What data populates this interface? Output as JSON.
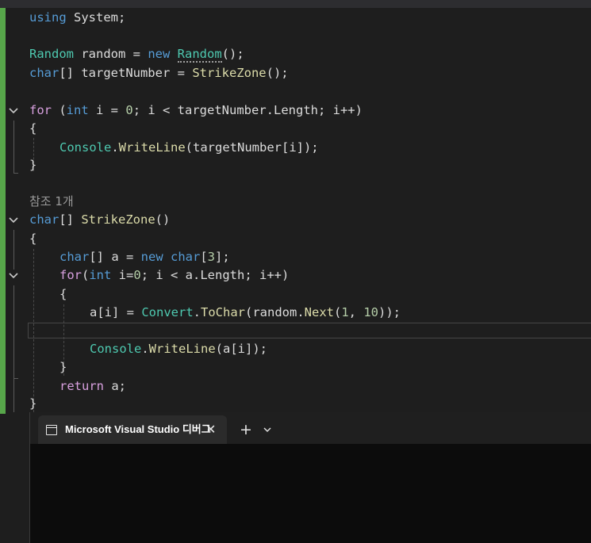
{
  "editor": {
    "lines": {
      "l1": [
        "using",
        " System;"
      ],
      "l3": [
        "Random",
        " random = ",
        "new",
        " ",
        "Random",
        "();"
      ],
      "l4": [
        "char",
        "[] targetNumber = ",
        "StrikeZone",
        "();"
      ],
      "l6": [
        "for",
        " (",
        "int",
        " i = ",
        "0",
        "; i < targetNumber.Length; i++)"
      ],
      "l7": "{",
      "l8": [
        "Console",
        ".",
        "WriteLine",
        "(targetNumber[i]);"
      ],
      "l9": "}",
      "codelens": "참조 1개",
      "l11": [
        "char",
        "[] ",
        "StrikeZone",
        "()"
      ],
      "l12": "{",
      "l13": [
        "char",
        "[] a = ",
        "new",
        " ",
        "char",
        "[",
        "3",
        "];"
      ],
      "l14": [
        "for",
        "(",
        "int",
        " i=",
        "0",
        "; i < a.Length; i++)"
      ],
      "l15": "{",
      "l16": [
        "a[i] = ",
        "Convert",
        ".",
        "ToChar",
        "(random.",
        "Next",
        "(",
        "1",
        ", ",
        "10",
        "));"
      ],
      "l18": [
        "Console",
        ".",
        "WriteLine",
        "(a[i]);"
      ],
      "l19": "}",
      "l20": [
        "return",
        " a;"
      ],
      "l21": "}"
    }
  },
  "terminal": {
    "tab_title": "Microsoft Visual Studio 디버그",
    "close_glyph": "✕",
    "add_glyph": "+"
  },
  "colors": {
    "keyword": "#569cd6",
    "control": "#d8a0df",
    "type": "#4ec9b0",
    "method": "#dcdcaa",
    "number": "#b5cea8",
    "change_bar": "#57a64a"
  }
}
